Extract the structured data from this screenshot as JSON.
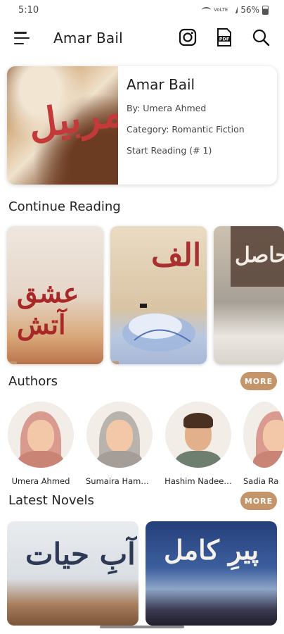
{
  "status": {
    "time": "5:10",
    "battery": "56%",
    "network": "VoLTE"
  },
  "appbar": {
    "title": "Amar Bail"
  },
  "featured": {
    "title": "Amar Bail",
    "author": "By: Umera Ahmed",
    "category": "Category: Romantic Fiction",
    "start": "Start Reading (# 1)",
    "cover_text": "امربیل"
  },
  "sections": {
    "continue": "Continue Reading",
    "authors": "Authors",
    "latest": "Latest Novels",
    "more_label": "MORE"
  },
  "continue_books": [
    {
      "cover_text": "عشق آتش",
      "progress": 0.05
    },
    {
      "cover_text": "الف",
      "progress": 0.05
    },
    {
      "cover_text": "حاصل",
      "progress": 0.0
    }
  ],
  "authors": [
    {
      "name": "Umera Ahmed",
      "style": "hijab-pink"
    },
    {
      "name": "Sumaira Hame…",
      "style": "hijab-grey"
    },
    {
      "name": "Hashim Nadee…",
      "style": "man"
    },
    {
      "name": "Sadia Ra",
      "style": "hijab-pink"
    }
  ],
  "latest_novels": [
    {
      "cover_text": "آبِ حیات"
    },
    {
      "cover_text": "پیرِ کامل"
    }
  ],
  "colors": {
    "accent": "#c4946a",
    "text": "#1f1f1f"
  }
}
